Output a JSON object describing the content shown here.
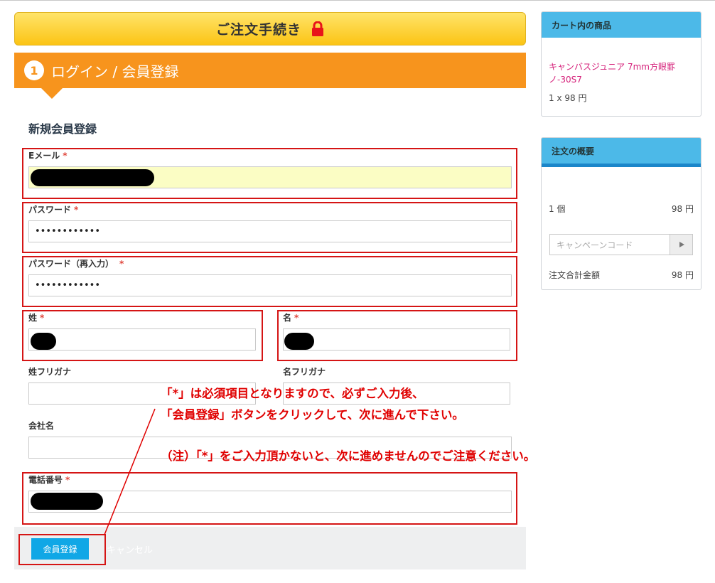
{
  "header": {
    "title": "ご注文手続き",
    "lock_icon": "lock-icon",
    "lock_color": "#e8141a"
  },
  "step": {
    "number": "1",
    "title": "ログイン / 会員登録",
    "color": "#f7941d"
  },
  "form": {
    "section_title": "新規会員登録",
    "required_mark": "*",
    "email": {
      "label": "Eメール"
    },
    "password": {
      "label": "パスワード",
      "value": "••••••••••••"
    },
    "password_confirm": {
      "label": "パスワード（再入力）",
      "value": "••••••••••••"
    },
    "last_name": {
      "label": "姓"
    },
    "first_name": {
      "label": "名"
    },
    "last_name_kana": {
      "label": "姓フリガナ"
    },
    "first_name_kana": {
      "label": "名フリガナ"
    },
    "company": {
      "label": "会社名"
    },
    "phone": {
      "label": "電話番号"
    }
  },
  "buttons": {
    "register": "会員登録",
    "cancel": "キャンセル",
    "register_color": "#10a7e6"
  },
  "annotation": {
    "line1": "「*」は必須項目となりますので、必ずご入力後、",
    "line2": "「会員登録」ボタンをクリックして、次に進んで下さい。",
    "line3": "（注）「*」をご入力頂かないと、次に進めませんのでご注意ください。",
    "color": "#e00000"
  },
  "cart": {
    "title": "カート内の商品",
    "item_name": "キャンバスジュニア 7mm方眼罫ノ-30S7",
    "item_qty": "1 x 98 円"
  },
  "summary": {
    "title": "注文の概要",
    "count_label": "1 個",
    "count_value": "98 円",
    "campaign_placeholder": "キャンペーンコード",
    "total_label": "注文合計金額",
    "total_value": "98 円"
  }
}
